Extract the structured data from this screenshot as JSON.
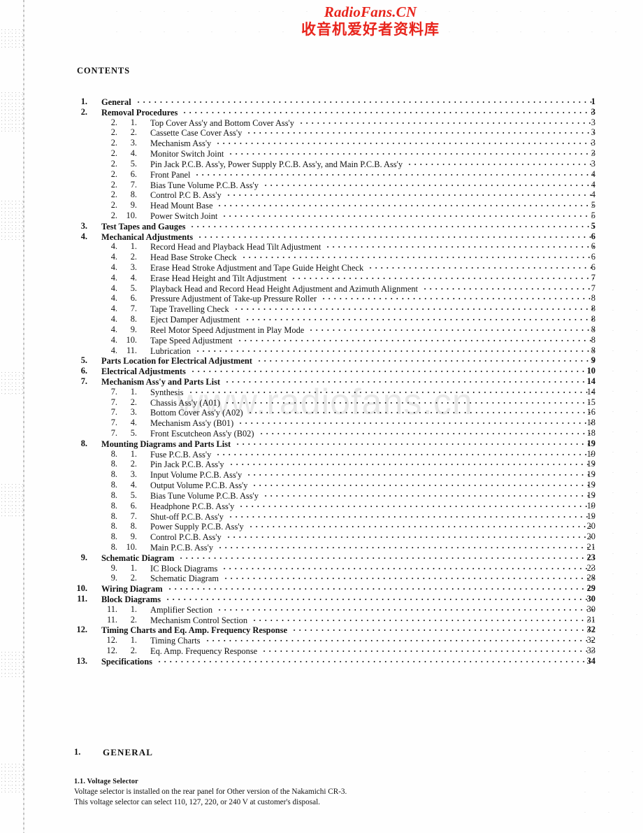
{
  "site_logo": {
    "latin": "RadioFans.CN",
    "cjk": "收音机爱好者资料库",
    "color": "#e8241c"
  },
  "watermark": {
    "text": "www.radiofans.cn"
  },
  "contents": {
    "heading": "CONTENTS",
    "entries": [
      {
        "level": 1,
        "num_a": "1.",
        "num_b": "",
        "title": "General",
        "page": "1"
      },
      {
        "level": 1,
        "num_a": "2.",
        "num_b": "",
        "title": "Removal Procedures",
        "page": "3"
      },
      {
        "level": 2,
        "num_a": "2.",
        "num_b": "1.",
        "title": "Top Cover Ass'y and Bottom Cover Ass'y",
        "page": "3"
      },
      {
        "level": 2,
        "num_a": "2.",
        "num_b": "2.",
        "title": "Cassette Case Cover Ass'y",
        "page": "3"
      },
      {
        "level": 2,
        "num_a": "2.",
        "num_b": "3.",
        "title": "Mechanism Ass'y",
        "page": "3"
      },
      {
        "level": 2,
        "num_a": "2.",
        "num_b": "4.",
        "title": "Monitor Switch Joint",
        "page": "3"
      },
      {
        "level": 2,
        "num_a": "2.",
        "num_b": "5.",
        "title": "Pin Jack P.C.B. Ass'y, Power Supply P.C.B. Ass'y, and Main P.C.B. Ass'y",
        "page": "3"
      },
      {
        "level": 2,
        "num_a": "2.",
        "num_b": "6.",
        "title": "Front Panel",
        "page": "4"
      },
      {
        "level": 2,
        "num_a": "2.",
        "num_b": "7.",
        "title": "Bias Tune Volume P.C.B. Ass'y",
        "page": "4"
      },
      {
        "level": 2,
        "num_a": "2.",
        "num_b": "8.",
        "title": "Control P.C B. Ass'y",
        "page": "4"
      },
      {
        "level": 2,
        "num_a": "2.",
        "num_b": "9.",
        "title": "Head Mount Base",
        "page": "5"
      },
      {
        "level": 2,
        "num_a": "2.",
        "num_b": "10.",
        "title": "Power Switch Joint",
        "page": "5"
      },
      {
        "level": 1,
        "num_a": "3.",
        "num_b": "",
        "title": "Test Tapes and Gauges",
        "page": "5"
      },
      {
        "level": 1,
        "num_a": "4.",
        "num_b": "",
        "title": "Mechanical Adjustments",
        "page": "6"
      },
      {
        "level": 2,
        "num_a": "4.",
        "num_b": "1.",
        "title": "Record Head and Playback Head Tilt Adjustment",
        "page": "6"
      },
      {
        "level": 2,
        "num_a": "4.",
        "num_b": "2.",
        "title": "Head Base Stroke Check",
        "page": "6"
      },
      {
        "level": 2,
        "num_a": "4.",
        "num_b": "3.",
        "title": "Erase Head Stroke Adjustment and Tape Guide Height Check",
        "page": "6"
      },
      {
        "level": 2,
        "num_a": "4.",
        "num_b": "4.",
        "title": "Erase Head Height and Tilt Adjustment",
        "page": "7"
      },
      {
        "level": 2,
        "num_a": "4.",
        "num_b": "5.",
        "title": "Playback Head and Record Head Height Adjustment and Azimuth Alignment",
        "page": "7"
      },
      {
        "level": 2,
        "num_a": "4.",
        "num_b": "6.",
        "title": "Pressure Adjustment of Take-up Pressure Roller",
        "page": "8"
      },
      {
        "level": 2,
        "num_a": "4.",
        "num_b": "7.",
        "title": "Tape Travelling Check",
        "page": "8"
      },
      {
        "level": 2,
        "num_a": "4.",
        "num_b": "8.",
        "title": "Eject Damper Adjustment",
        "page": "8"
      },
      {
        "level": 2,
        "num_a": "4.",
        "num_b": "9.",
        "title": "Reel Motor Speed Adjustment in Play Mode",
        "page": "8"
      },
      {
        "level": 2,
        "num_a": "4.",
        "num_b": "10.",
        "title": "Tape Speed Adjustment",
        "page": "8"
      },
      {
        "level": 2,
        "num_a": "4.",
        "num_b": "11.",
        "title": "Lubrication",
        "page": "8"
      },
      {
        "level": 1,
        "num_a": "5.",
        "num_b": "",
        "title": "Parts Location for Electrical Adjustment",
        "page": "9"
      },
      {
        "level": 1,
        "num_a": "6.",
        "num_b": "",
        "title": "Electrical Adjustments",
        "page": "10"
      },
      {
        "level": 1,
        "num_a": "7.",
        "num_b": "",
        "title": "Mechanism Ass'y and Parts List",
        "page": "14"
      },
      {
        "level": 2,
        "num_a": "7.",
        "num_b": "1.",
        "title": "Synthesis",
        "page": "14"
      },
      {
        "level": 2,
        "num_a": "7.",
        "num_b": "2.",
        "title": "Chassis Ass'y (A01)",
        "page": "15"
      },
      {
        "level": 2,
        "num_a": "7.",
        "num_b": "3.",
        "title": "Bottom Cover Ass'y (A02)",
        "page": "16"
      },
      {
        "level": 2,
        "num_a": "7.",
        "num_b": "4.",
        "title": "Mechanism Ass'y (B01)",
        "page": "18"
      },
      {
        "level": 2,
        "num_a": "7.",
        "num_b": "5.",
        "title": "Front Escutcheon Ass'y (B02)",
        "page": "18"
      },
      {
        "level": 1,
        "num_a": "8.",
        "num_b": "",
        "title": "Mounting Diagrams and Parts List",
        "page": "19"
      },
      {
        "level": 2,
        "num_a": "8.",
        "num_b": "1.",
        "title": "Fuse P.C.B. Ass'y",
        "page": "19"
      },
      {
        "level": 2,
        "num_a": "8.",
        "num_b": "2.",
        "title": "Pin Jack P.C.B. Ass'y",
        "page": "19"
      },
      {
        "level": 2,
        "num_a": "8.",
        "num_b": "3.",
        "title": "Input Volume P.C.B. Ass'y",
        "page": "19"
      },
      {
        "level": 2,
        "num_a": "8.",
        "num_b": "4.",
        "title": "Output Volume P.C.B. Ass'y",
        "page": "19"
      },
      {
        "level": 2,
        "num_a": "8.",
        "num_b": "5.",
        "title": "Bias Tune Volume P.C.B. Ass'y",
        "page": "19"
      },
      {
        "level": 2,
        "num_a": "8.",
        "num_b": "6.",
        "title": "Headphone P.C.B. Ass'y",
        "page": "19"
      },
      {
        "level": 2,
        "num_a": "8.",
        "num_b": "7.",
        "title": "Shut-off P.C.B. Ass'y",
        "page": "19"
      },
      {
        "level": 2,
        "num_a": "8.",
        "num_b": "8.",
        "title": "Power Supply P.C.B. Ass'y",
        "page": "20"
      },
      {
        "level": 2,
        "num_a": "8.",
        "num_b": "9.",
        "title": "Control P.C.B. Ass'y",
        "page": "20"
      },
      {
        "level": 2,
        "num_a": "8.",
        "num_b": "10.",
        "title": "Main P.C.B. Ass'y",
        "page": "21"
      },
      {
        "level": 1,
        "num_a": "9.",
        "num_b": "",
        "title": "Schematic Diagram",
        "page": "23"
      },
      {
        "level": 2,
        "num_a": "9.",
        "num_b": "1.",
        "title": "IC Block Diagrams",
        "page": "23"
      },
      {
        "level": 2,
        "num_a": "9.",
        "num_b": "2.",
        "title": "Schematic Diagram",
        "page": "28"
      },
      {
        "level": 1,
        "num_a": "10.",
        "num_b": "",
        "title": "Wiring Diagram",
        "page": "29"
      },
      {
        "level": 1,
        "num_a": "11.",
        "num_b": "",
        "title": "Block Diagrams",
        "page": "30"
      },
      {
        "level": 2,
        "num_a": "11.",
        "num_b": "1.",
        "title": "Amplifier Section",
        "page": "30"
      },
      {
        "level": 2,
        "num_a": "11.",
        "num_b": "2.",
        "title": "Mechanism Control Section",
        "page": "31"
      },
      {
        "level": 1,
        "num_a": "12.",
        "num_b": "",
        "title": "Timing Charts and Eq. Amp. Frequency Response",
        "page": "32"
      },
      {
        "level": 2,
        "num_a": "12.",
        "num_b": "1.",
        "title": "Timing Charts",
        "page": "32"
      },
      {
        "level": 2,
        "num_a": "12.",
        "num_b": "2.",
        "title": "Eq. Amp. Frequency Response",
        "page": "33"
      },
      {
        "level": 1,
        "num_a": "13.",
        "num_b": "",
        "title": "Specifications",
        "page": "34"
      }
    ]
  },
  "section_general": {
    "number": "1.",
    "title": "GENERAL",
    "subsection_heading": "1.1.  Voltage Selector",
    "paragraph_line1": "Voltage selector is installed on the rear panel for Other version of the Nakamichi CR-3.",
    "paragraph_line2": "This voltage selector can select 110, 127, 220, or 240 V at customer's disposal."
  }
}
